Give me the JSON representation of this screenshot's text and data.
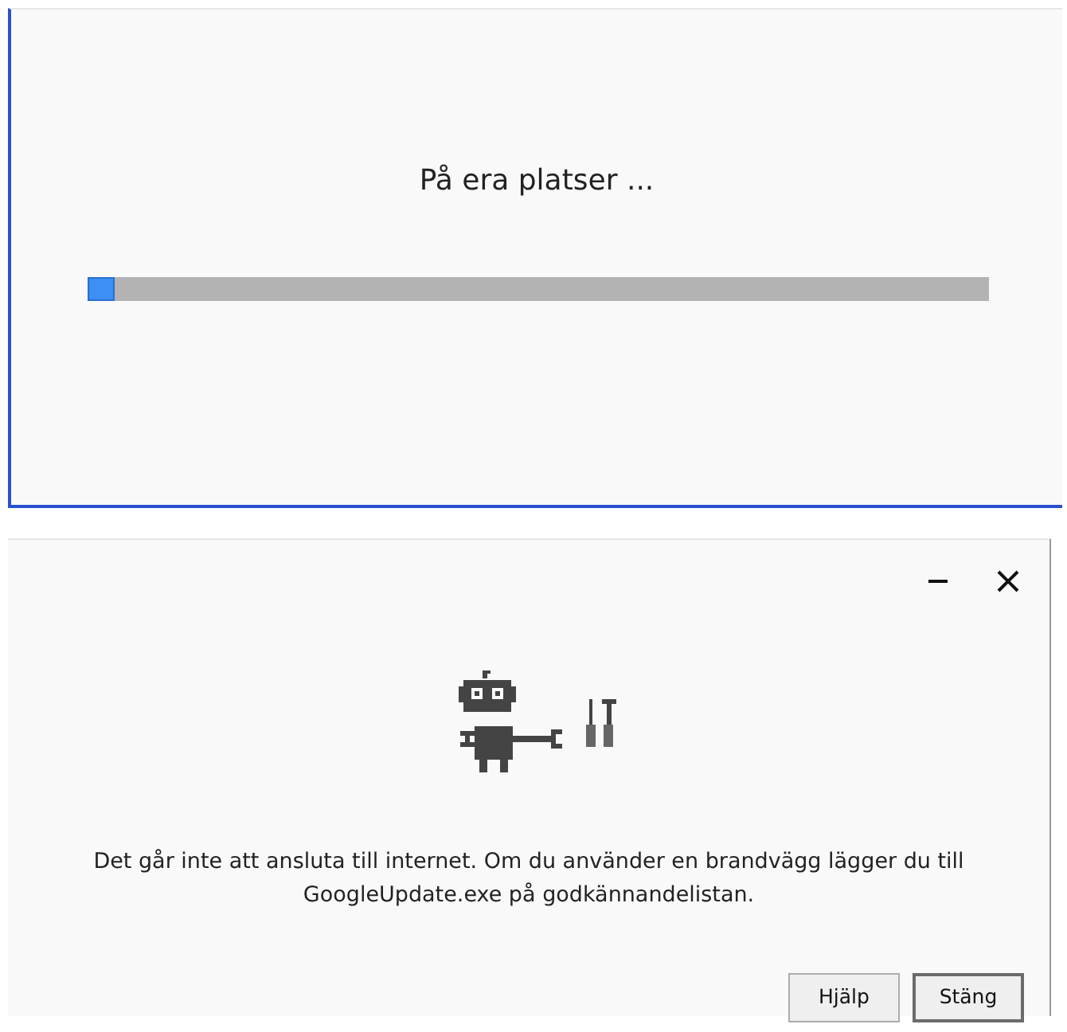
{
  "progress_window": {
    "status": "På era platser ...",
    "progress": {
      "level": 0.03
    }
  },
  "error_dialog": {
    "title_buttons": [
      {
        "kind": "minimize"
      },
      {
        "kind": "close"
      }
    ],
    "message": "Det går inte att ansluta till internet. Om du använder en brandvägg lägger du till GoogleUpdate.exe på godkännandelistan.",
    "buttons": [
      {
        "label": "Hjälp",
        "default": false
      },
      {
        "label": "Stäng",
        "default": true
      }
    ]
  }
}
